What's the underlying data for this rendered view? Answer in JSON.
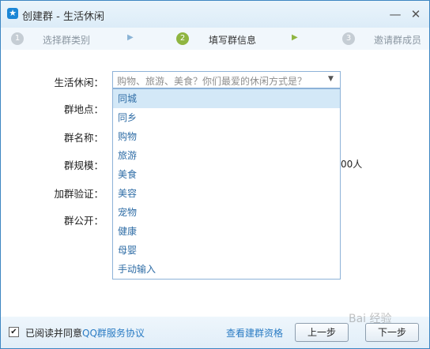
{
  "window": {
    "title": "创建群 - 生活休闲",
    "min_symbol": "—",
    "close_symbol": "✕"
  },
  "steps": [
    {
      "number": "1",
      "label": "选择群类别"
    },
    {
      "number": "2",
      "label": "填写群信息"
    },
    {
      "number": "3",
      "label": "邀请群成员"
    }
  ],
  "form": {
    "labels": [
      "生活休闲：",
      "群地点：",
      "群名称：",
      "群规模：",
      "加群验证：",
      "群公开："
    ],
    "select_placeholder": "购物、旅游、美食？你们最爱的休闲方式是？",
    "behind_partial_text": "00人"
  },
  "dropdown": {
    "options": [
      "同城",
      "同乡",
      "购物",
      "旅游",
      "美食",
      "美容",
      "宠物",
      "健康",
      "母婴",
      "手动输入"
    ],
    "selected_index": 0
  },
  "footer": {
    "checkbox_checked": true,
    "agree_text": "已阅读并同意",
    "agree_link": "QQ群服务协议",
    "qual_link": "查看建群资格",
    "prev_button": "上一步",
    "next_button": "下一步"
  },
  "watermark": "Bai 经验"
}
